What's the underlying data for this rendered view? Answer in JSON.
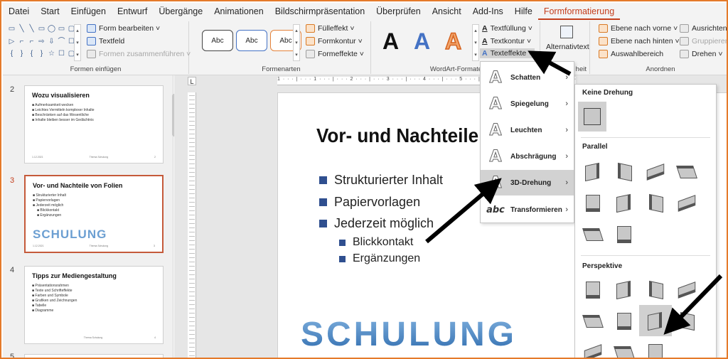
{
  "menubar": {
    "tabs": [
      "Datei",
      "Start",
      "Einfügen",
      "Entwurf",
      "Übergänge",
      "Animationen",
      "Bildschirmpräsentation",
      "Überprüfen",
      "Ansicht",
      "Add-Ins",
      "Hilfe",
      "Formformatierung"
    ],
    "active_tab": "Formformatierung"
  },
  "ribbon": {
    "formen_einfuegen": {
      "label": "Formen einfügen",
      "form_bearbeiten": "Form bearbeiten ˅",
      "textfeld": "Textfeld",
      "formen_zusammenfuehren": "Formen zusammenführen ˅",
      "shapes": [
        "▭",
        "╲",
        "╲",
        "▭",
        "◯",
        "▭",
        "▢",
        "▷",
        "⌐",
        "⌐",
        "⇨",
        "⇩",
        "⌒",
        "☐",
        "{",
        "}",
        "{",
        "}",
        "☆",
        "☐",
        "▢"
      ]
    },
    "formenarten": {
      "label": "Formenarten",
      "styles": [
        "Abc",
        "Abc",
        "Abc"
      ],
      "fuelleffekt": "Fülleffekt ˅",
      "formkontur": "Formkontur ˅",
      "formeffekte": "Formeffekte ˅"
    },
    "wordart": {
      "label": "WordArt-Formate",
      "textfuellung": "Textfüllung ˅",
      "textkontur": "Textkontur ˅",
      "texteffekte": "Texteffekte ˅",
      "glyph": "A"
    },
    "barrierefreiheit": {
      "alternativtext": "Alternativtext",
      "label_partial": "heit"
    },
    "anordnen": {
      "label": "Anordnen",
      "ebene_nach_vorne": "Ebene nach vorne ˅",
      "ebene_nach_hinten": "Ebene nach hinten ˅",
      "auswahlbereich": "Auswahlbereich",
      "ausrichten": "Ausrichten ˅",
      "gruppieren": "Gruppieren ˅",
      "drehen": "Drehen ˅"
    }
  },
  "thumbnails": [
    {
      "num": "2",
      "title": "Wozu visualisieren",
      "lines": [
        "Aufmerksamkeit wecken",
        "Leichtes Vermitteln komplexer Inhalte",
        "Beschränken auf das Wesentliche",
        "Inhalte bleiben besser im Gedächtnis"
      ],
      "footer_left": "1.12.2021",
      "footer_mid": "Thema Schulung",
      "footer_right": "2"
    },
    {
      "num": "3",
      "title": "Vor- und Nachteile von Folien",
      "lines": [
        "Strukturierter Inhalt",
        "Papiervorlagen",
        "Jederzeit möglich"
      ],
      "sublines": [
        "Blickkontakt",
        "Ergänzungen"
      ],
      "logo": "SCHULUNG",
      "footer_left": "1.12.2021",
      "footer_mid": "Thema Schulung",
      "footer_right": "3"
    },
    {
      "num": "4",
      "title": "Tipps zur Mediengestaltung",
      "lines": [
        "Präsentationsrahmen",
        "Texte und Schrifteffekte",
        "Farben und Symbole",
        "Grafiken und Zeichnungen",
        "Tabelle",
        "Diagramme"
      ],
      "footer_left": "",
      "footer_mid": "Thema Schulung",
      "footer_right": "4"
    },
    {
      "num": "5"
    }
  ],
  "rulers": {
    "horizontal": "1 · · · | · · · 1 · · · | · · · 2 · · · | · · · 3 · · · | · · · 4 · · · | · · · 5 · · · | · · · 6 · · · | · · · 7 · · · | · · · 8 · · · | · · · 9 · · · | · · · 10 · · · | · · · 11 · · · | · · · 12 · · · | · · 13 · · 14 · · 15 · · 16 ·",
    "corner": "L"
  },
  "slide": {
    "title": "Vor- und Nachteile",
    "bullets": [
      "Strukturierter Inhalt",
      "Papiervorlagen",
      "Jederzeit möglich"
    ],
    "subbullets": [
      "Blickkontakt",
      "Ergänzungen"
    ],
    "logo": "SCHULUNG"
  },
  "texteffekte_menu": {
    "items": [
      {
        "label": "Schatten",
        "glyph": "A"
      },
      {
        "label": "Spiegelung",
        "glyph": "A"
      },
      {
        "label": "Leuchten",
        "glyph": "A"
      },
      {
        "label": "Abschrägung",
        "glyph": "A"
      },
      {
        "label": "3D-Drehung",
        "glyph": "A"
      },
      {
        "label": "Transformieren",
        "glyph": "abc"
      }
    ],
    "highlighted": "3D-Drehung",
    "arrow": "›"
  },
  "drehung_gallery": {
    "sections": [
      "Keine Drehung",
      "Parallel",
      "Perspektive"
    ]
  },
  "colors": {
    "accent": "#c43e1c",
    "frame": "#e47a2a",
    "bullet": "#2f4f8f",
    "logo": "#4a86c5"
  }
}
